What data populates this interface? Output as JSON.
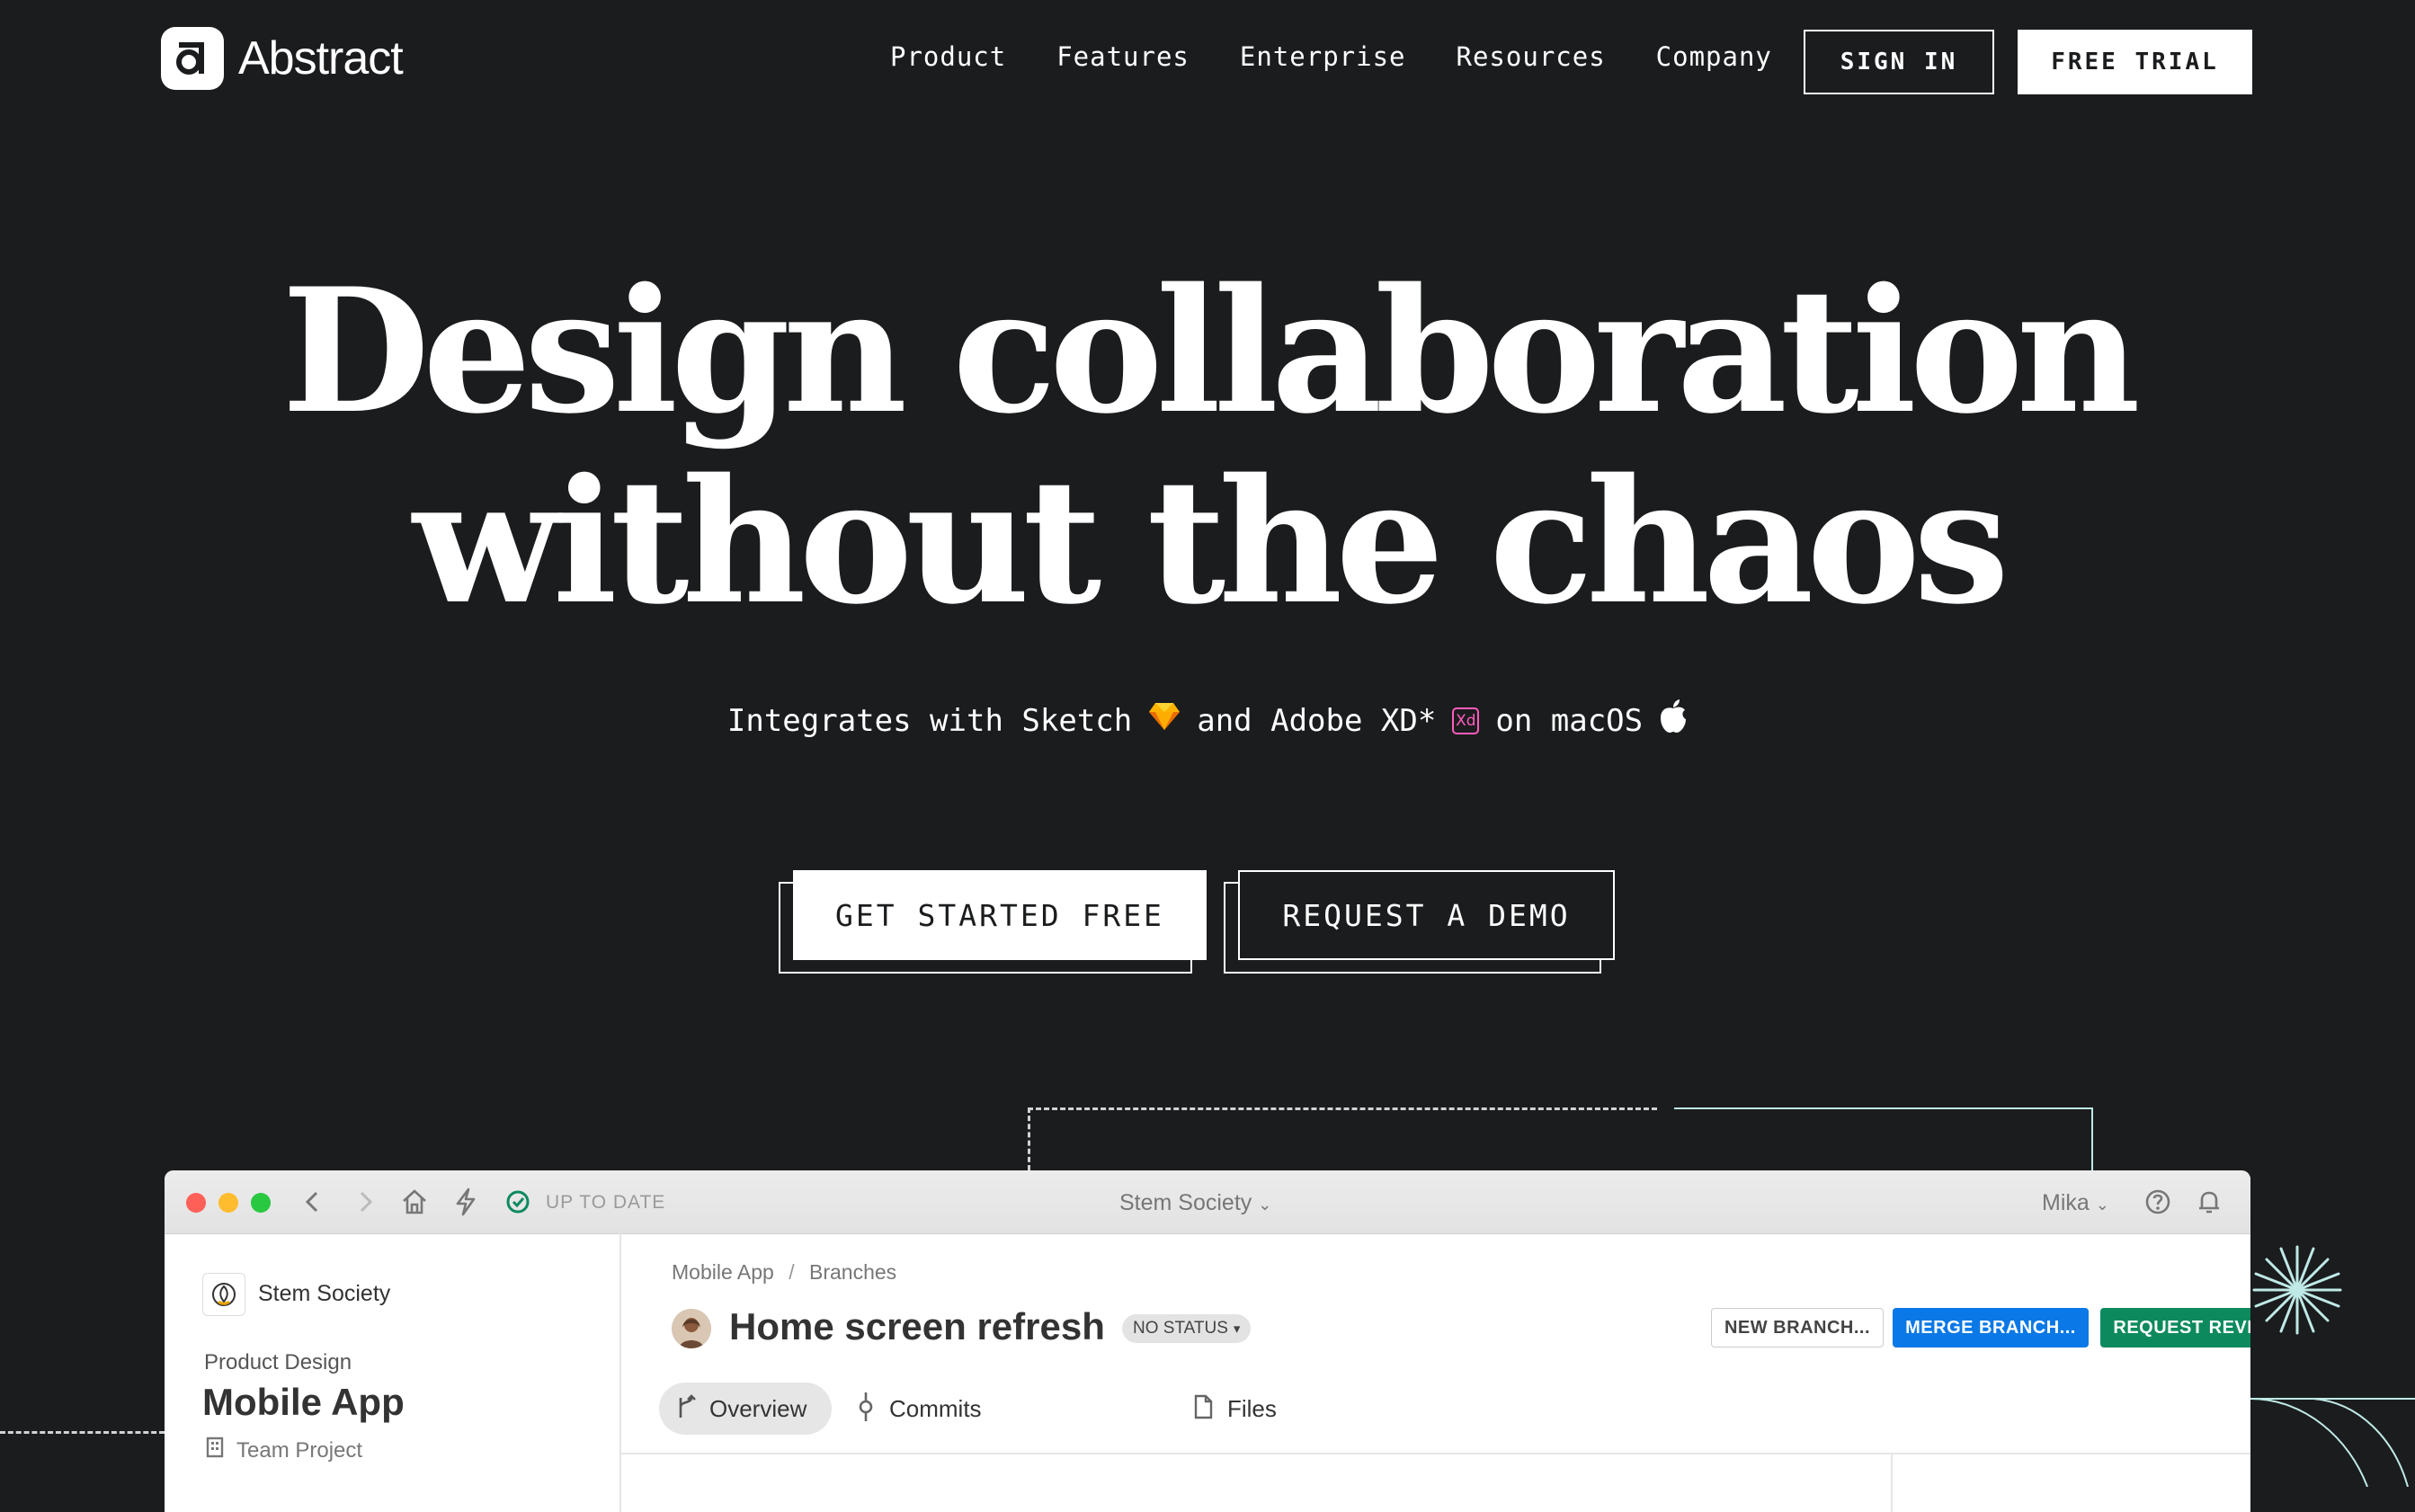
{
  "brand": {
    "name": "Abstract"
  },
  "nav": {
    "items": [
      "Product",
      "Features",
      "Enterprise",
      "Resources",
      "Company"
    ],
    "sign_in": "SIGN IN",
    "free_trial": "FREE TRIAL"
  },
  "hero": {
    "line1": "Design collaboration",
    "line2": "without the chaos",
    "subtitle": {
      "part1": "Integrates with Sketch",
      "part2": "and Adobe XD*",
      "xd_badge": "Xd",
      "part3": "on macOS"
    },
    "cta_primary": "GET STARTED FREE",
    "cta_secondary": "REQUEST A DEMO"
  },
  "app": {
    "status": "UP TO DATE",
    "org_switcher": "Stem Society",
    "user": "Mika",
    "sidebar": {
      "org": "Stem Society",
      "section": "Product Design",
      "project": "Mobile App",
      "project_type": "Team Project"
    },
    "breadcrumb": {
      "project": "Mobile App",
      "separator": "/",
      "section": "Branches"
    },
    "branch_title": "Home screen refresh",
    "status_badge": "NO STATUS",
    "actions": {
      "new_branch": "NEW BRANCH...",
      "merge_branch": "MERGE BRANCH...",
      "request_review": "REQUEST REVIEW..."
    },
    "tabs": [
      "Overview",
      "Commits",
      "Files"
    ]
  },
  "colors": {
    "background": "#1b1c1e",
    "merge_button": "#0a78e6",
    "review_button": "#0c8a5e",
    "accent_line": "#bfe9e6",
    "xd_pink": "#ff5cbc",
    "sketch_yellow": "#fdb300"
  }
}
